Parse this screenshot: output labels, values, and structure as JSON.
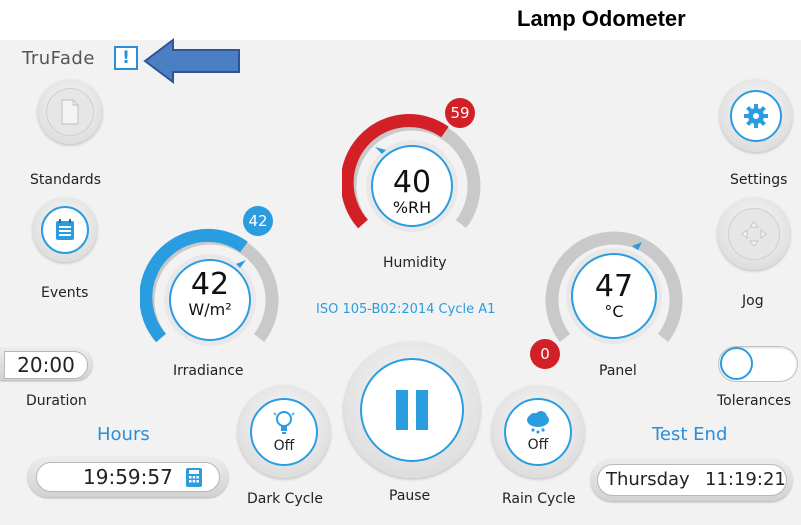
{
  "page": {
    "heading": "Lamp Odometer"
  },
  "brand": {
    "name": "TruFade",
    "alert_glyph": "!"
  },
  "left_column": {
    "standards_label": "Standards",
    "events_label": "Events",
    "duration_value": "20:00",
    "duration_label": "Duration",
    "hours_title": "Hours",
    "hours_value": "19:59:57"
  },
  "right_column": {
    "settings_label": "Settings",
    "jog_label": "Jog",
    "tolerances_label": "Tolerances",
    "test_end_title": "Test End",
    "test_end_day": "Thursday",
    "test_end_time": "11:19:21"
  },
  "gauges": {
    "irradiance": {
      "value": "42",
      "unit": "W/m²",
      "setpoint": "42",
      "label": "Irradiance",
      "color": "#2a9de0"
    },
    "humidity": {
      "value": "40",
      "unit": "%RH",
      "setpoint": "59",
      "label": "Humidity",
      "color": "#d32027"
    },
    "panel": {
      "value": "47",
      "unit": "°C",
      "setpoint": "0",
      "label": "Panel",
      "color": "#d32027"
    }
  },
  "cycle_name": "ISO 105-B02:2014 Cycle A1",
  "controls": {
    "dark_cycle": {
      "state": "Off",
      "label": "Dark Cycle"
    },
    "pause_label": "Pause",
    "rain_cycle": {
      "state": "Off",
      "label": "Rain Cycle"
    }
  },
  "colors": {
    "accent_blue": "#2a8fd8",
    "alert_red": "#d32027",
    "arrow_blue": "#4a7fc4"
  }
}
